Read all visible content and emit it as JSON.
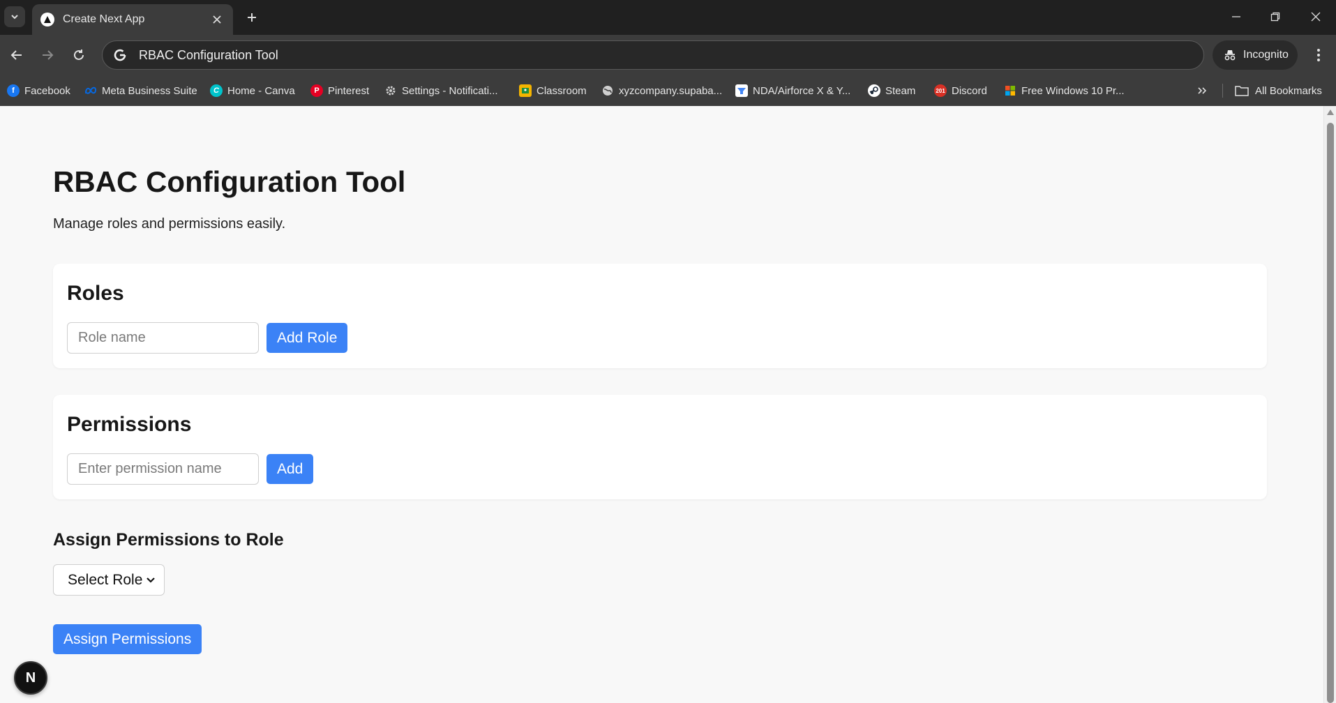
{
  "browser": {
    "tab_title": "Create Next App",
    "omnibox_text": "RBAC Configuration Tool",
    "incognito_label": "Incognito",
    "all_bookmarks_label": "All Bookmarks",
    "bookmarks": [
      {
        "label": "Facebook",
        "icon": "facebook-icon",
        "color": "#1877f2"
      },
      {
        "label": "Meta Business Suite",
        "icon": "meta-icon",
        "color": "#0668e1"
      },
      {
        "label": "Home - Canva",
        "icon": "canva-icon",
        "color": "#00c4cc"
      },
      {
        "label": "Pinterest",
        "icon": "pinterest-icon",
        "color": "#e60023"
      },
      {
        "label": "Settings - Notificati...",
        "icon": "gear-icon",
        "color": "#cfcfcf"
      },
      {
        "label": "Classroom",
        "icon": "classroom-icon",
        "color": "#f4b400"
      },
      {
        "label": "xyzcompany.supaba...",
        "icon": "globe-icon",
        "color": "#cfcfcf"
      },
      {
        "label": "NDA/Airforce X & Y...",
        "icon": "form-icon",
        "color": "#4285f4"
      },
      {
        "label": "Steam",
        "icon": "steam-icon",
        "color": "#1b2838"
      },
      {
        "label": "Discord",
        "icon": "calendar-icon",
        "color": "#d93025"
      },
      {
        "label": "Free Windows 10 Pr...",
        "icon": "windows-icon",
        "color": "#0078d4"
      }
    ]
  },
  "page": {
    "title": "RBAC Configuration Tool",
    "subtitle": "Manage roles and permissions easily.",
    "roles": {
      "heading": "Roles",
      "input_placeholder": "Role name",
      "add_button": "Add Role"
    },
    "permissions": {
      "heading": "Permissions",
      "input_placeholder": "Enter permission name",
      "add_button": "Add"
    },
    "assign": {
      "heading": "Assign Permissions to Role",
      "select_value": "Select Role",
      "button": "Assign Permissions"
    },
    "next_badge": "N"
  },
  "colors": {
    "accent": "#3b82f6",
    "page_bg": "#f8f8f8"
  }
}
